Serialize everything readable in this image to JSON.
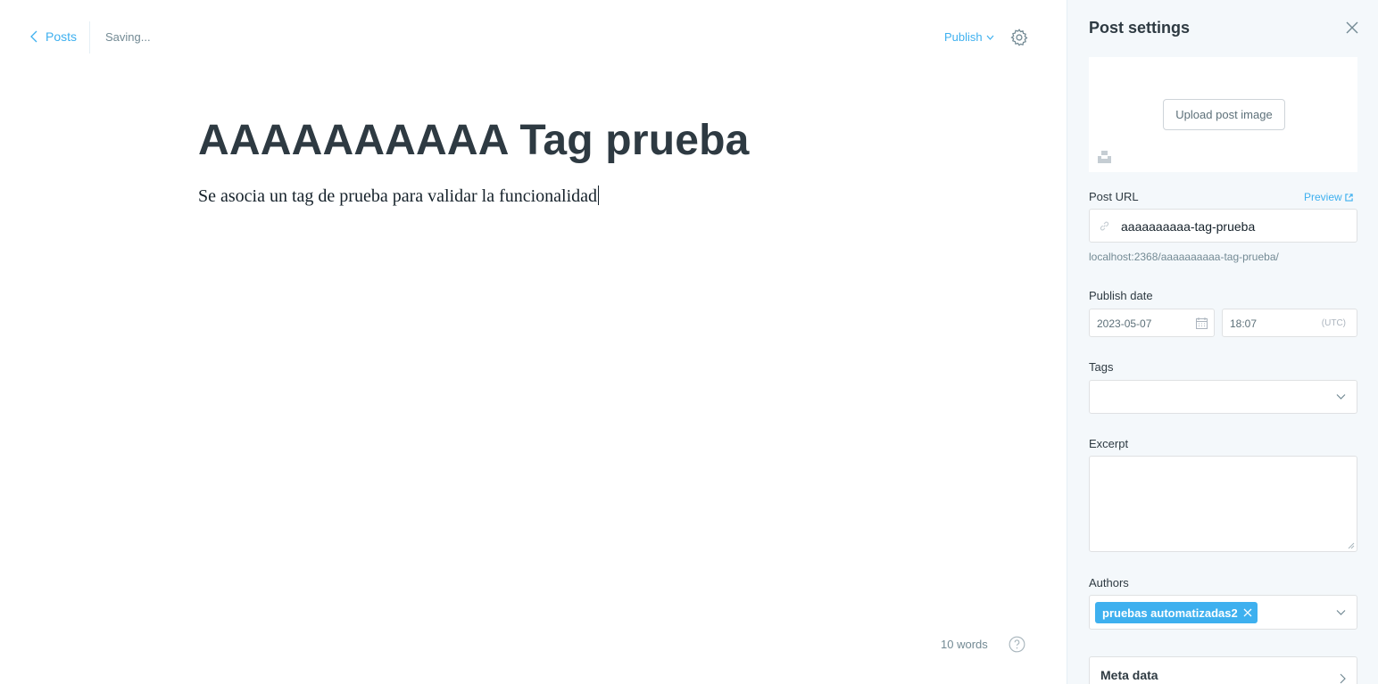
{
  "editor": {
    "back_label": "Posts",
    "status": "Saving...",
    "publish_label": "Publish",
    "title": "AAAAAAAAAA Tag prueba",
    "body": "Se asocia un tag de prueba para validar la funcionalidad",
    "word_count": "10 words"
  },
  "settings": {
    "title": "Post settings",
    "upload_label": "Upload post image",
    "post_url_label": "Post URL",
    "preview_label": "Preview",
    "slug": "aaaaaaaaaa-tag-prueba",
    "full_url": "localhost:2368/aaaaaaaaaa-tag-prueba/",
    "publish_date_label": "Publish date",
    "date": "2023-05-07",
    "time": "18:07",
    "timezone": "(UTC)",
    "tags_label": "Tags",
    "excerpt_label": "Excerpt",
    "excerpt_value": "",
    "authors_label": "Authors",
    "author": "pruebas automatizadas2",
    "meta_label": "Meta data"
  },
  "colors": {
    "accent": "#3eb0ef",
    "panel_bg": "#f4f8fb",
    "text_dark": "#2e3a42",
    "muted": "#738a94"
  },
  "icons": [
    "chevron-left-icon",
    "chevron-down-icon",
    "gear-icon",
    "close-icon",
    "image-icon",
    "external-link-icon",
    "link-icon",
    "calendar-icon",
    "help-icon",
    "chevron-right-icon"
  ]
}
